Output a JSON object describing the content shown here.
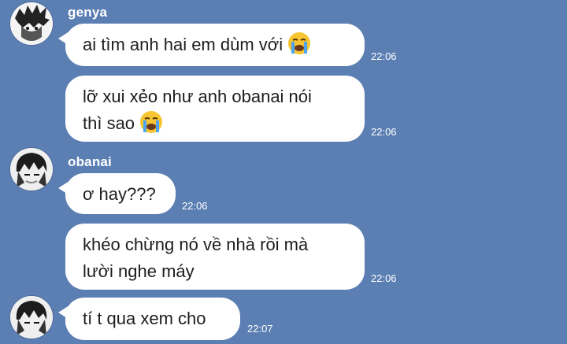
{
  "messages": [
    {
      "sender": "genya",
      "text": "ai tìm anh hai em dùm với",
      "emoji": "loudly-crying-face",
      "time": "22:06"
    },
    {
      "sender": "",
      "text_lines": [
        "lỡ xui xẻo như anh obanai nói",
        "thì sao"
      ],
      "emoji": "loudly-crying-face",
      "time": "22:06"
    },
    {
      "sender": "obanai",
      "text": "ơ hay???",
      "time": "22:06"
    },
    {
      "sender": "",
      "text_lines": [
        "khéo chừng nó về nhà rồi mà",
        "lười nghe máy"
      ],
      "time": "22:06"
    },
    {
      "sender": "",
      "text": "tí t qua xem cho",
      "time": "22:07"
    }
  ],
  "colors": {
    "background": "#5b7eb3",
    "bubble": "#ffffff",
    "text": "#1d1d1d"
  }
}
